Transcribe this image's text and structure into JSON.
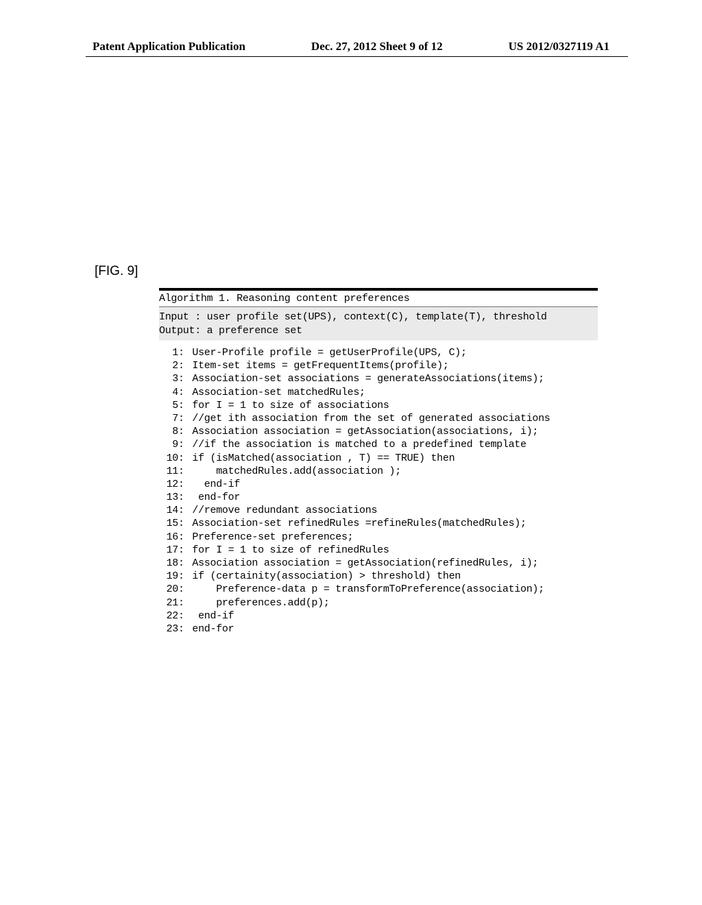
{
  "header": {
    "left": "Patent Application Publication",
    "center": "Dec. 27, 2012  Sheet 9 of 12",
    "right": "US 2012/0327119 A1"
  },
  "figure_label": "[FIG. 9]",
  "algorithm": {
    "title": "Algorithm 1. Reasoning content preferences",
    "input": "Input : user profile set(UPS), context(C), template(T), threshold",
    "output": "Output: a preference set",
    "lines": [
      {
        "n": "1",
        "text": "User-Profile profile = getUserProfile(UPS, C);"
      },
      {
        "n": "2",
        "text": "Item-set items = getFrequentItems(profile);"
      },
      {
        "n": "3",
        "text": "Association-set associations = generateAssociations(items);"
      },
      {
        "n": "4",
        "text": "Association-set matchedRules;"
      },
      {
        "n": "5",
        "text": "for I = 1 to size of associations"
      },
      {
        "n": "7",
        "text": "//get ith association from the set of generated associations"
      },
      {
        "n": "8",
        "text": "Association association = getAssociation(associations, i);"
      },
      {
        "n": "9",
        "text": "//if the association is matched to a predefined template"
      },
      {
        "n": "10",
        "text": "if (isMatched(association , T) == TRUE) then"
      },
      {
        "n": "11",
        "text": "    matchedRules.add(association );"
      },
      {
        "n": "12",
        "text": "  end-if"
      },
      {
        "n": "13",
        "text": " end-for"
      },
      {
        "n": "14",
        "text": "//remove redundant associations"
      },
      {
        "n": "15",
        "text": "Association-set refinedRules =refineRules(matchedRules);"
      },
      {
        "n": "16",
        "text": "Preference-set preferences;"
      },
      {
        "n": "17",
        "text": "for I = 1 to size of refinedRules"
      },
      {
        "n": "18",
        "text": "Association association = getAssociation(refinedRules, i);"
      },
      {
        "n": "19",
        "text": "if (certainity(association) > threshold) then"
      },
      {
        "n": "20",
        "text": "    Preference-data p = transformToPreference(association);"
      },
      {
        "n": "21",
        "text": "    preferences.add(p);"
      },
      {
        "n": "22",
        "text": " end-if"
      },
      {
        "n": "23",
        "text": "end-for"
      }
    ]
  }
}
